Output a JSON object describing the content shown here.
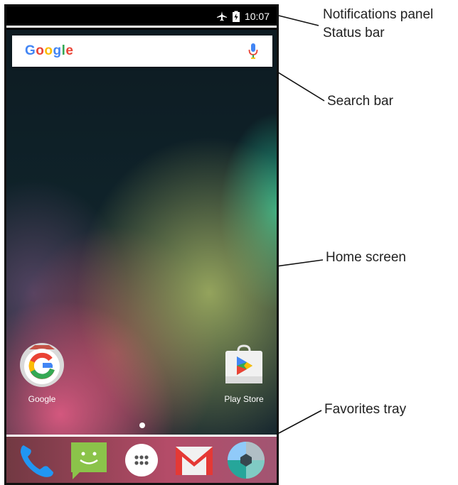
{
  "status_bar": {
    "time": "10:07",
    "icons": [
      "airplane-icon",
      "battery-icon"
    ]
  },
  "search_bar": {
    "logo_text": [
      "G",
      "o",
      "o",
      "g",
      "l",
      "e"
    ],
    "icon": "mic-icon"
  },
  "home_apps": [
    {
      "name": "google",
      "label": "Google"
    },
    {
      "name": "play-store",
      "label": "Play Store"
    }
  ],
  "favorites_tray": [
    "phone-icon",
    "messaging-icon",
    "app-drawer-icon",
    "gmail-icon",
    "camera-icon"
  ],
  "callouts": {
    "notifications_panel": "Notifications panel",
    "status_bar": "Status bar",
    "search_bar": "Search bar",
    "home_screen": "Home screen",
    "favorites_tray": "Favorites tray"
  }
}
